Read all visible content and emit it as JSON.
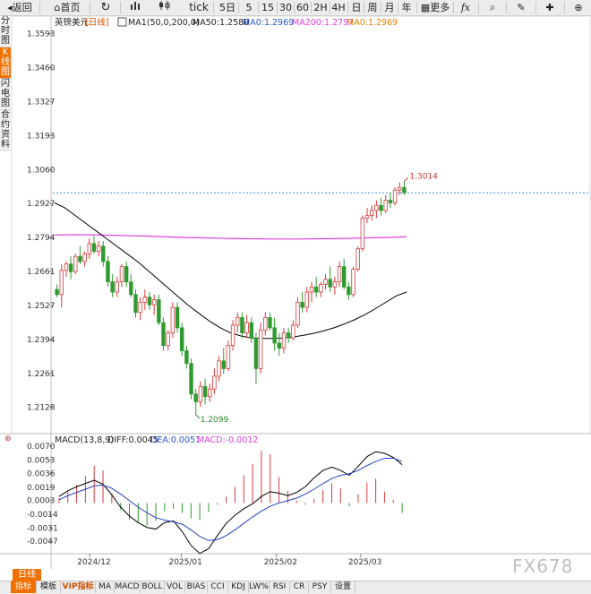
{
  "toolbar": {
    "back": "返回",
    "home": "首页",
    "tick": "tick",
    "periods": [
      "5日",
      "5",
      "15",
      "30",
      "60",
      "2H",
      "4H",
      "日",
      "周",
      "月",
      "年"
    ],
    "more": "更多",
    "fx": "fx"
  },
  "side_tabs": [
    {
      "label": "分时图",
      "active": false
    },
    {
      "label": "K线图",
      "active": true
    },
    {
      "label": "闪电图",
      "active": false
    },
    {
      "label": "合约资料",
      "active": false
    }
  ],
  "header": {
    "symbol": "英镑美元",
    "period": "[日线]",
    "ma_group": "MA1(50,0,200,0)",
    "ma50": "MA50:1.2580",
    "ma0_a": "MA0:1.2969",
    "ma200": "MA200:1.2797",
    "ma0_b": "MA0:1.2969"
  },
  "macd_header": {
    "title": "MACD(13,8,9)",
    "diff": "DIFF:0.0045",
    "dea": "DEA:0.0051",
    "macd": "MACD:-0.0012"
  },
  "bottom_bar": {
    "period_tab": "日线",
    "tabs": [
      "指标",
      "模板",
      "VIP指标",
      "MA",
      "MACD",
      "BOLL",
      "VOL",
      "BIAS",
      "CCI",
      "KDJ",
      "LW%",
      "RSI",
      "CR",
      "PSY",
      "设置"
    ]
  },
  "watermark": "FX678",
  "colors": {
    "up": "#d93a3a",
    "down": "#2f9a2f",
    "ma50": "#000000",
    "ma200": "#e040e0",
    "macd_diff": "#000000",
    "macd_dea": "#2040c0",
    "current_line": "#3a8fd8"
  },
  "chart_data": [
    {
      "type": "candlestick",
      "title": "英镑美元 [日线]",
      "y_ticks": [
        "1.3593",
        "1.3460",
        "1.3327",
        "1.3193",
        "1.3060",
        "1.2927",
        "1.2794",
        "1.2661",
        "1.2527",
        "1.2394",
        "1.2261",
        "1.2128"
      ],
      "ylim": [
        1.206,
        1.362
      ],
      "x_ticks": [
        "2024/12",
        "2025/01",
        "2025/02",
        "2025/03"
      ],
      "annotations": {
        "high_label": "1.3014",
        "low_label": "1.2099",
        "current_price": 1.2969
      },
      "candles": [
        [
          1.259,
          1.261,
          1.256,
          1.257
        ],
        [
          1.257,
          1.269,
          1.252,
          1.2665
        ],
        [
          1.2665,
          1.27,
          1.264,
          1.269
        ],
        [
          1.269,
          1.272,
          1.263,
          1.266
        ],
        [
          1.266,
          1.273,
          1.265,
          1.272
        ],
        [
          1.272,
          1.276,
          1.269,
          1.27
        ],
        [
          1.27,
          1.274,
          1.268,
          1.273
        ],
        [
          1.273,
          1.279,
          1.271,
          1.277
        ],
        [
          1.277,
          1.28,
          1.273,
          1.274
        ],
        [
          1.274,
          1.278,
          1.272,
          1.276
        ],
        [
          1.276,
          1.278,
          1.268,
          1.27
        ],
        [
          1.27,
          1.272,
          1.26,
          1.262
        ],
        [
          1.262,
          1.265,
          1.256,
          1.258
        ],
        [
          1.258,
          1.264,
          1.256,
          1.262
        ],
        [
          1.262,
          1.269,
          1.26,
          1.268
        ],
        [
          1.268,
          1.27,
          1.26,
          1.262
        ],
        [
          1.262,
          1.265,
          1.256,
          1.257
        ],
        [
          1.257,
          1.259,
          1.248,
          1.25
        ],
        [
          1.25,
          1.256,
          1.247,
          1.254
        ],
        [
          1.254,
          1.259,
          1.251,
          1.256
        ],
        [
          1.256,
          1.258,
          1.251,
          1.253
        ],
        [
          1.253,
          1.257,
          1.249,
          1.255
        ],
        [
          1.255,
          1.257,
          1.245,
          1.246
        ],
        [
          1.246,
          1.248,
          1.235,
          1.237
        ],
        [
          1.237,
          1.243,
          1.235,
          1.242
        ],
        [
          1.242,
          1.254,
          1.24,
          1.252
        ],
        [
          1.252,
          1.254,
          1.242,
          1.244
        ],
        [
          1.244,
          1.246,
          1.233,
          1.235
        ],
        [
          1.235,
          1.237,
          1.228,
          1.23
        ],
        [
          1.23,
          1.232,
          1.216,
          1.218
        ],
        [
          1.218,
          1.22,
          1.2099,
          1.215
        ],
        [
          1.215,
          1.223,
          1.213,
          1.221
        ],
        [
          1.221,
          1.224,
          1.214,
          1.217
        ],
        [
          1.217,
          1.222,
          1.215,
          1.22
        ],
        [
          1.22,
          1.228,
          1.218,
          1.225
        ],
        [
          1.225,
          1.233,
          1.223,
          1.231
        ],
        [
          1.231,
          1.236,
          1.226,
          1.228
        ],
        [
          1.228,
          1.239,
          1.227,
          1.237
        ],
        [
          1.237,
          1.247,
          1.235,
          1.245
        ],
        [
          1.245,
          1.25,
          1.242,
          1.248
        ],
        [
          1.248,
          1.25,
          1.24,
          1.242
        ],
        [
          1.242,
          1.249,
          1.24,
          1.246
        ],
        [
          1.246,
          1.248,
          1.238,
          1.24
        ],
        [
          1.24,
          1.242,
          1.222,
          1.228
        ],
        [
          1.228,
          1.246,
          1.226,
          1.243
        ],
        [
          1.243,
          1.25,
          1.241,
          1.248
        ],
        [
          1.248,
          1.25,
          1.243,
          1.244
        ],
        [
          1.244,
          1.248,
          1.235,
          1.238
        ],
        [
          1.238,
          1.242,
          1.233,
          1.236
        ],
        [
          1.236,
          1.244,
          1.234,
          1.242
        ],
        [
          1.242,
          1.244,
          1.238,
          1.24
        ],
        [
          1.24,
          1.247,
          1.239,
          1.245
        ],
        [
          1.245,
          1.256,
          1.244,
          1.254
        ],
        [
          1.254,
          1.258,
          1.25,
          1.252
        ],
        [
          1.252,
          1.26,
          1.25,
          1.258
        ],
        [
          1.258,
          1.262,
          1.254,
          1.26
        ],
        [
          1.26,
          1.264,
          1.256,
          1.258
        ],
        [
          1.258,
          1.262,
          1.256,
          1.261
        ],
        [
          1.261,
          1.265,
          1.259,
          1.263
        ],
        [
          1.263,
          1.268,
          1.258,
          1.26
        ],
        [
          1.26,
          1.264,
          1.257,
          1.262
        ],
        [
          1.262,
          1.27,
          1.26,
          1.268
        ],
        [
          1.268,
          1.271,
          1.259,
          1.26
        ],
        [
          1.26,
          1.262,
          1.255,
          1.257
        ],
        [
          1.257,
          1.268,
          1.256,
          1.267
        ],
        [
          1.267,
          1.276,
          1.266,
          1.275
        ],
        [
          1.275,
          1.288,
          1.274,
          1.287
        ],
        [
          1.287,
          1.291,
          1.285,
          1.288
        ],
        [
          1.288,
          1.292,
          1.286,
          1.29
        ],
        [
          1.29,
          1.294,
          1.287,
          1.292
        ],
        [
          1.292,
          1.295,
          1.288,
          1.29
        ],
        [
          1.29,
          1.296,
          1.289,
          1.294
        ],
        [
          1.294,
          1.297,
          1.291,
          1.293
        ],
        [
          1.293,
          1.299,
          1.292,
          1.298
        ],
        [
          1.298,
          1.301,
          1.296,
          1.299
        ],
        [
          1.299,
          1.3014,
          1.296,
          1.297
        ]
      ],
      "ma50": [
        1.293,
        1.291,
        1.288,
        1.285,
        1.282,
        1.279,
        1.276,
        1.273,
        1.27,
        1.2665,
        1.263,
        1.2595,
        1.256,
        1.2525,
        1.2495,
        1.2465,
        1.244,
        1.242,
        1.2408,
        1.24,
        1.2398,
        1.2398,
        1.24,
        1.2404,
        1.241,
        1.2418,
        1.2428,
        1.244,
        1.2455,
        1.2472,
        1.2492,
        1.2515,
        1.254,
        1.2565,
        1.258
      ],
      "ma200": [
        1.2804,
        1.2805,
        1.2804,
        1.2802,
        1.28,
        1.2797,
        1.2794,
        1.2792,
        1.279,
        1.2789,
        1.2788,
        1.2788,
        1.2789,
        1.279,
        1.2792,
        1.2794,
        1.2797
      ]
    },
    {
      "type": "macd",
      "title": "MACD(13,8,9)",
      "y_ticks": [
        "0.0070",
        "0.0053",
        "0.0036",
        "0.0019",
        "0.0003",
        "-0.0014",
        "-0.0031",
        "-0.0047"
      ],
      "ylim": [
        -0.006,
        0.0072
      ],
      "diff": [
        0.0008,
        0.0015,
        0.002,
        0.0024,
        0.0028,
        0.0023,
        0.001,
        -0.0005,
        -0.0016,
        -0.0024,
        -0.003,
        -0.0032,
        -0.0024,
        -0.0022,
        -0.0035,
        -0.0052,
        -0.0062,
        -0.0056,
        -0.004,
        -0.0025,
        -0.0015,
        -0.0007,
        -0.0001,
        0.0008,
        0.0014,
        0.0012,
        0.0009,
        0.0013,
        0.002,
        0.0031,
        0.004,
        0.0044,
        0.004,
        0.0034,
        0.0045,
        0.0057,
        0.0063,
        0.0061,
        0.0056,
        0.0047
      ],
      "dea": [
        0.0004,
        0.0009,
        0.0013,
        0.0017,
        0.0021,
        0.0022,
        0.0018,
        0.0011,
        0.0003,
        -0.0005,
        -0.0012,
        -0.0018,
        -0.0021,
        -0.0023,
        -0.0026,
        -0.0033,
        -0.0041,
        -0.0046,
        -0.0045,
        -0.004,
        -0.0033,
        -0.0025,
        -0.0017,
        -0.001,
        -0.0004,
        0.0,
        0.0003,
        0.0006,
        0.0011,
        0.0017,
        0.0024,
        0.003,
        0.0034,
        0.0036,
        0.004,
        0.0046,
        0.0051,
        0.0055,
        0.0055,
        0.0051
      ],
      "macd": [
        0.0006,
        0.0014,
        0.0022,
        0.0033,
        0.0046,
        0.004,
        0.0012,
        -0.0008,
        -0.002,
        -0.0025,
        -0.0028,
        -0.0022,
        -0.001,
        -0.0007,
        -0.0012,
        -0.0019,
        -0.0021,
        -0.0011,
        -0.0002,
        0.0008,
        0.002,
        0.0034,
        0.0048,
        0.0064,
        0.006,
        0.0032,
        0.0015,
        0.0003,
        -0.0002,
        0.0005,
        0.0016,
        0.0024,
        0.0018,
        -0.0004,
        0.0011,
        0.0025,
        0.003,
        0.0014,
        0.0004,
        -0.0012
      ]
    }
  ]
}
